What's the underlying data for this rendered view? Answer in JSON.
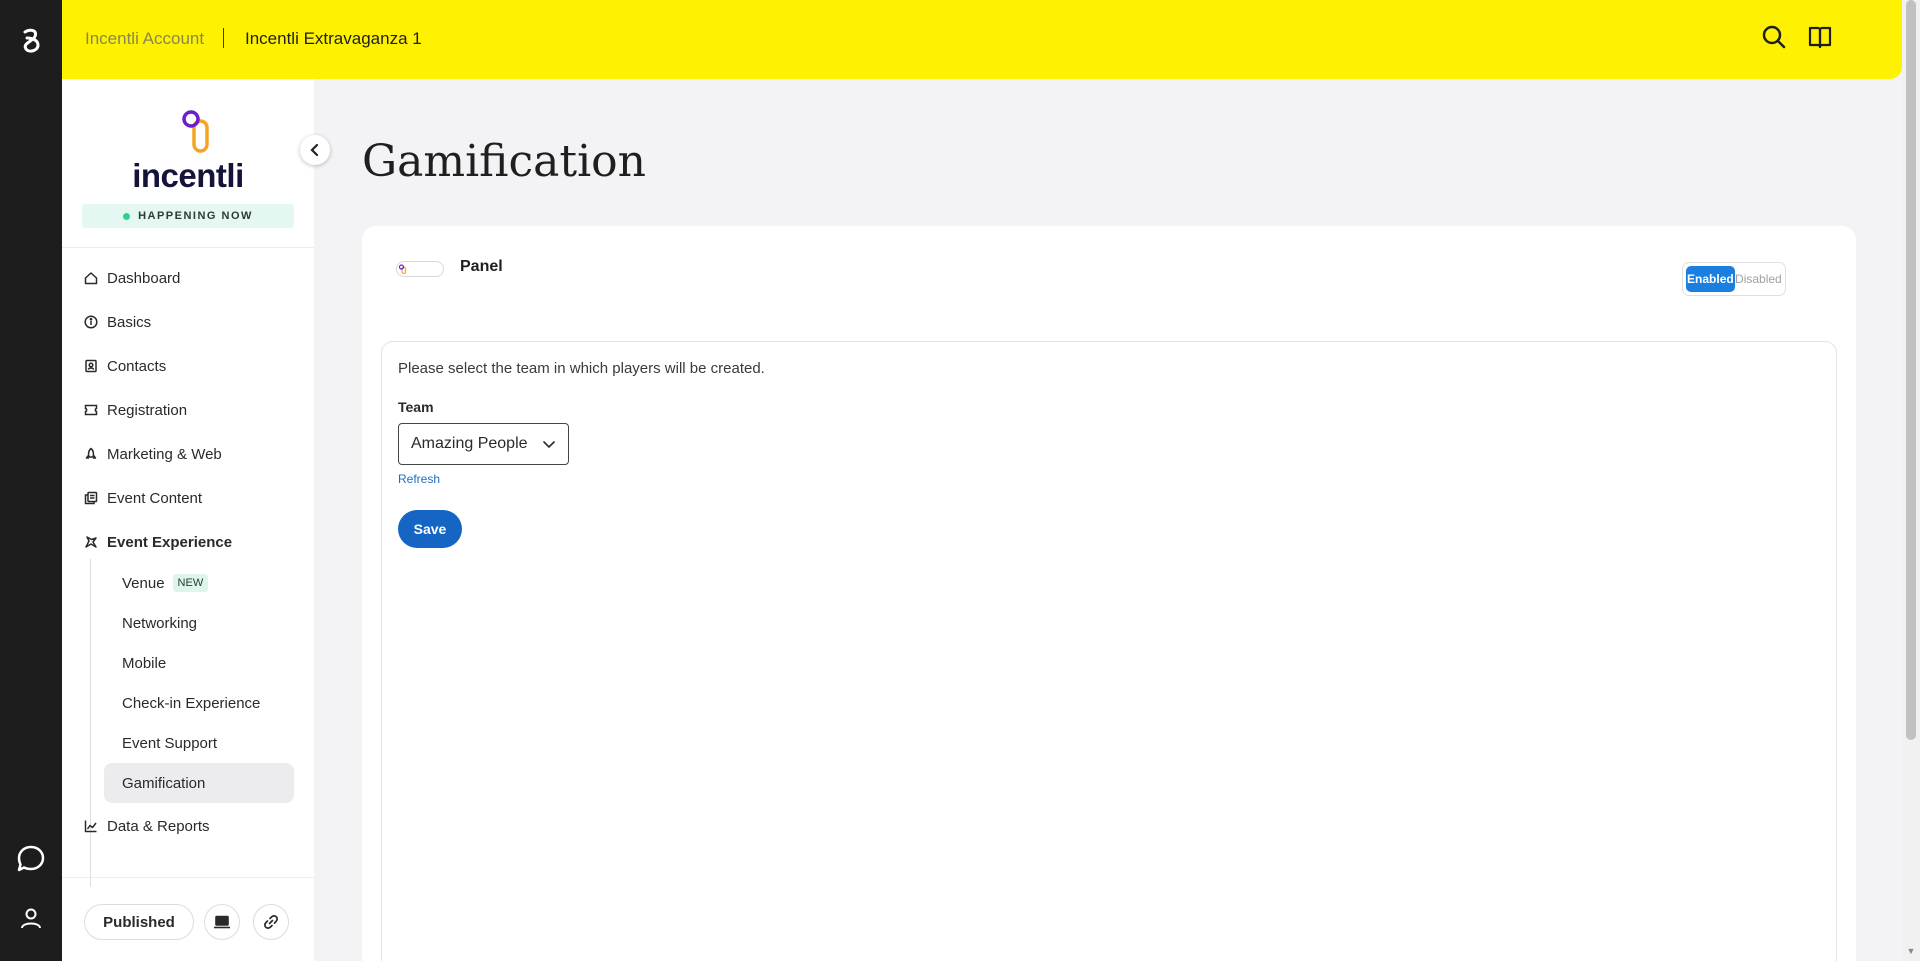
{
  "topbar": {
    "account": "Incentli Account",
    "event": "Incentli Extravaganza 1"
  },
  "brand": {
    "name": "incentli",
    "status": "HAPPENING NOW"
  },
  "nav": {
    "items": [
      {
        "label": "Dashboard",
        "icon": "home-icon"
      },
      {
        "label": "Basics",
        "icon": "info-icon"
      },
      {
        "label": "Contacts",
        "icon": "contacts-icon"
      },
      {
        "label": "Registration",
        "icon": "ticket-icon"
      },
      {
        "label": "Marketing & Web",
        "icon": "rocket-icon"
      },
      {
        "label": "Event Content",
        "icon": "copy-icon"
      },
      {
        "label": "Event Experience",
        "icon": "sparkle-icon"
      }
    ],
    "sub_items": [
      {
        "label": "Venue",
        "badge": "NEW"
      },
      {
        "label": "Networking"
      },
      {
        "label": "Mobile"
      },
      {
        "label": "Check-in Experience"
      },
      {
        "label": "Event Support"
      },
      {
        "label": "Gamification"
      }
    ],
    "data_reports": "Data & Reports"
  },
  "footer": {
    "published": "Published"
  },
  "page": {
    "title": "Gamification",
    "panel_title": "Panel",
    "toggle": {
      "enabled": "Enabled",
      "disabled": "Disabled",
      "selected": "Enabled"
    },
    "instruction": "Please select the team in which players will be created.",
    "team_label": "Team",
    "team_value": "Amazing People",
    "refresh": "Refresh",
    "save": "Save"
  },
  "colors": {
    "topbar": "#fff200",
    "rail": "#1d1d1d",
    "accent": "#1566c4",
    "toggle_on": "#1a7fe0"
  }
}
